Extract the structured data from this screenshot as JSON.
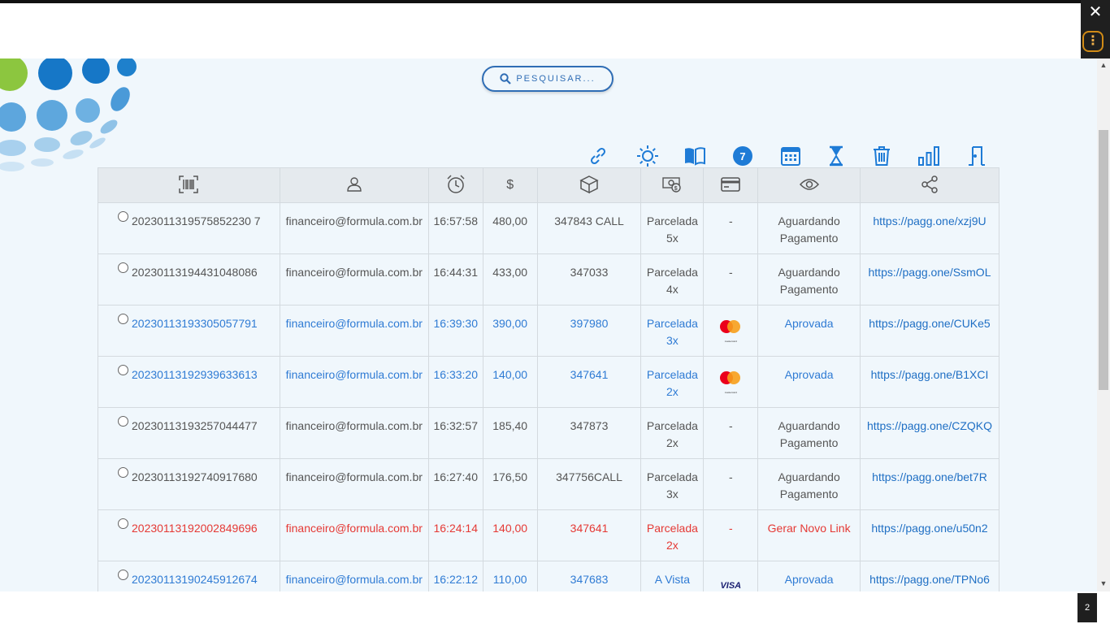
{
  "search": {
    "label": "PESQUISAR..."
  },
  "toolbar": {
    "badge_count": "7",
    "icons": [
      "link-icon",
      "sun-icon",
      "book-icon",
      "counter-badge",
      "calendar-icon",
      "hourglass-icon",
      "trash-icon",
      "bar-chart-icon",
      "exit-door-icon"
    ]
  },
  "table": {
    "header_icons": [
      "barcode-icon",
      "user-icon",
      "alarm-clock-icon",
      "dollar-icon",
      "box-icon",
      "money-icon",
      "credit-card-icon",
      "eye-icon",
      "share-icon"
    ],
    "header_texts": {
      "currency": "$"
    },
    "rows": [
      {
        "id": "2023011319575852230 7",
        "email": "financeiro@formula.com.br",
        "time": "16:57:58",
        "value": "480,00",
        "ref": "347843 CALL",
        "plan_line1": "Parcelada",
        "plan_line2": "5x",
        "card": "-",
        "status_line1": "Aguardando",
        "status_line2": "Pagamento",
        "link": "https://pagg.one/xzj9U",
        "state": "pending"
      },
      {
        "id": "20230113194431048086",
        "email": "financeiro@formula.com.br",
        "time": "16:44:31",
        "value": "433,00",
        "ref": "347033",
        "plan_line1": "Parcelada",
        "plan_line2": "4x",
        "card": "-",
        "status_line1": "Aguardando",
        "status_line2": "Pagamento",
        "link": "https://pagg.one/SsmOL",
        "state": "pending"
      },
      {
        "id": "20230113193305057791",
        "email": "financeiro@formula.com.br",
        "time": "16:39:30",
        "value": "390,00",
        "ref": "397980",
        "plan_line1": "Parcelada",
        "plan_line2": "3x",
        "card": "mastercard",
        "status_line1": "Aprovada",
        "status_line2": "",
        "link": "https://pagg.one/CUKe5",
        "state": "approved"
      },
      {
        "id": "20230113192939633613",
        "email": "financeiro@formula.com.br",
        "time": "16:33:20",
        "value": "140,00",
        "ref": "347641",
        "plan_line1": "Parcelada",
        "plan_line2": "2x",
        "card": "mastercard",
        "status_line1": "Aprovada",
        "status_line2": "",
        "link": "https://pagg.one/B1XCI",
        "state": "approved"
      },
      {
        "id": "20230113193257044477",
        "email": "financeiro@formula.com.br",
        "time": "16:32:57",
        "value": "185,40",
        "ref": "347873",
        "plan_line1": "Parcelada",
        "plan_line2": "2x",
        "card": "-",
        "status_line1": "Aguardando",
        "status_line2": "Pagamento",
        "link": "https://pagg.one/CZQKQ",
        "state": "pending"
      },
      {
        "id": "20230113192740917680",
        "email": "financeiro@formula.com.br",
        "time": "16:27:40",
        "value": "176,50",
        "ref": "347756CALL",
        "plan_line1": "Parcelada",
        "plan_line2": "3x",
        "card": "-",
        "status_line1": "Aguardando",
        "status_line2": "Pagamento",
        "link": "https://pagg.one/bet7R",
        "state": "pending"
      },
      {
        "id": "20230113192002849696",
        "email": "financeiro@formula.com.br",
        "time": "16:24:14",
        "value": "140,00",
        "ref": "347641",
        "plan_line1": "Parcelada",
        "plan_line2": "2x",
        "card": "-",
        "status_line1": "Gerar Novo Link",
        "status_line2": "",
        "link": "https://pagg.one/u50n2",
        "state": "failed"
      },
      {
        "id": "20230113190245912674",
        "email": "financeiro@formula.com.br",
        "time": "16:22:12",
        "value": "110,00",
        "ref": "347683",
        "plan_line1": "A Vista",
        "plan_line2": "",
        "card": "visa",
        "status_line1": "Aprovada",
        "status_line2": "",
        "link": "https://pagg.one/TPNo6",
        "state": "approved"
      }
    ]
  },
  "card_labels": {
    "mastercard": "mastercard",
    "visa": "VISA"
  },
  "browser": {
    "close_glyph": "✕",
    "menu_glyph": "⋮",
    "notifications_count": "2"
  },
  "colors": {
    "accent": "#1e7bd6",
    "approved": "#2f7bd4",
    "failed": "#e53935",
    "background": "#f0f7fc"
  }
}
